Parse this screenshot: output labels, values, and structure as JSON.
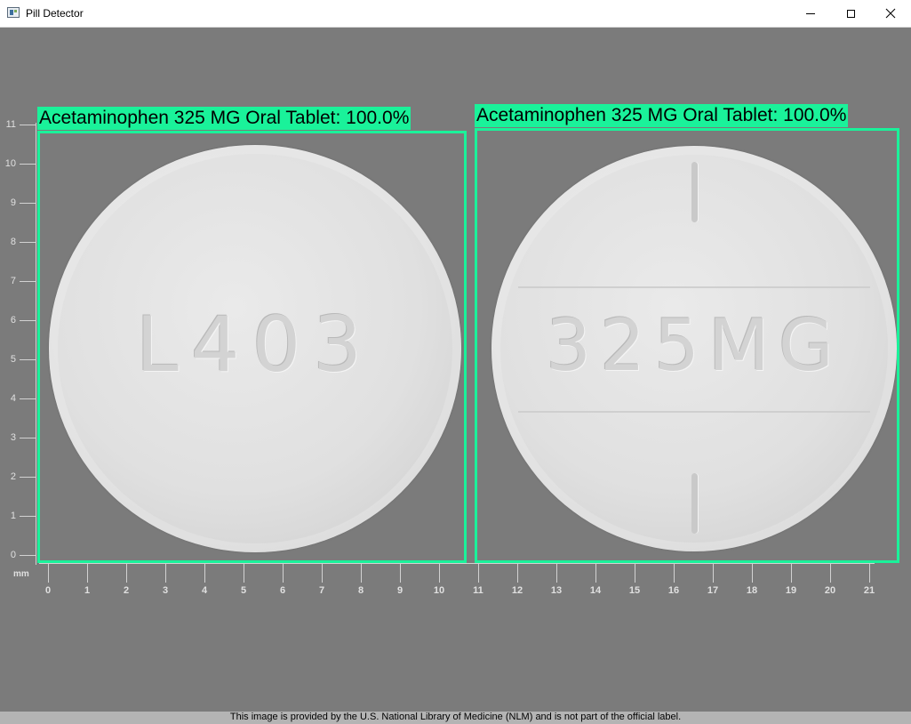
{
  "window": {
    "title": "Pill Detector",
    "controls": [
      "minimize",
      "maximize",
      "close"
    ]
  },
  "ruler": {
    "unit_label": "mm",
    "y_ticks": [
      "11",
      "10",
      "9",
      "8",
      "7",
      "6",
      "5",
      "4",
      "3",
      "2",
      "1",
      "0"
    ],
    "x_ticks": [
      "0",
      "1",
      "2",
      "3",
      "4",
      "5",
      "6",
      "7",
      "8",
      "9",
      "10",
      "11",
      "12",
      "13",
      "14",
      "15",
      "16",
      "17",
      "18",
      "19",
      "20",
      "21"
    ]
  },
  "pills": [
    {
      "imprint": "L403"
    },
    {
      "imprint": "325MG"
    }
  ],
  "detections": [
    {
      "label": "Acetaminophen 325 MG Oral Tablet: 100.0%",
      "color": "#1af29a"
    },
    {
      "label": "Acetaminophen 325 MG Oral Tablet: 100.0%",
      "color": "#1af29a"
    }
  ],
  "footer": {
    "text": "This image is provided by the U.S. National Library of Medicine (NLM) and is not part of the official label."
  },
  "colors": {
    "background": "#7b7b7b",
    "detection": "#1af29a"
  }
}
